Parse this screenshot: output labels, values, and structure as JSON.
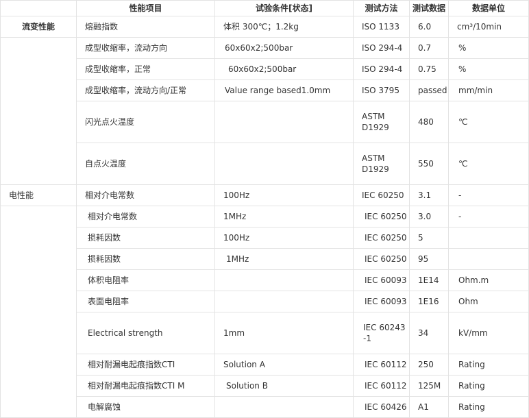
{
  "headers": {
    "category": "",
    "property": "性能项目",
    "condition": "试验条件[状态]",
    "method": "测试方法",
    "value": "测试数据",
    "unit": "数据单位"
  },
  "categories": {
    "rheology": "流变性能",
    "electrical": "电性能"
  },
  "rows": [
    {
      "property": "熔融指数",
      "condition": "体积 300℃；1.2kg",
      "method": "ISO 1133",
      "value": "6.0",
      "unit": "cm³/10min"
    },
    {
      "property": "成型收缩率，流动方向",
      "condition": "60x60x2;500bar",
      "method": "ISO 294-4",
      "value": "0.7",
      "unit": "%"
    },
    {
      "property": "成型收缩率，正常",
      "condition": "60x60x2;500bar",
      "method": "ISO 294-4",
      "value": "0.75",
      "unit": "%"
    },
    {
      "property": "成型收缩率，流动方向/正常",
      "condition": "Value range based1.0mm",
      "method": "ISO 3795",
      "value": "passed",
      "unit": "mm/min"
    },
    {
      "property": "闪光点火温度",
      "condition": "",
      "method": "ASTM D1929",
      "value": "480",
      "unit": "℃"
    },
    {
      "property": "自点火温度",
      "condition": "",
      "method": "ASTM D1929",
      "value": "550",
      "unit": "℃"
    },
    {
      "property": "相对介电常数",
      "condition": "100Hz",
      "method": "IEC 60250",
      "value": "3.1",
      "unit": "-"
    },
    {
      "property": "相对介电常数",
      "condition": "1MHz",
      "method": "IEC 60250",
      "value": "3.0",
      "unit": "-"
    },
    {
      "property": "损耗因数",
      "condition": "100Hz",
      "method": "IEC 60250",
      "value": "5",
      "unit": ""
    },
    {
      "property": "损耗因数",
      "condition": "1MHz",
      "method": "IEC 60250",
      "value": "95",
      "unit": ""
    },
    {
      "property": "体积电阻率",
      "condition": "",
      "method": "IEC 60093",
      "value": "1E14",
      "unit": "Ohm.m"
    },
    {
      "property": "表面电阻率",
      "condition": "",
      "method": "IEC 60093",
      "value": "1E16",
      "unit": "Ohm"
    },
    {
      "property": "Electrical strength",
      "condition": "1mm",
      "method": "IEC 60243-1",
      "value": "34",
      "unit": "kV/mm"
    },
    {
      "property": "相对耐漏电起痕指数CTI",
      "condition": "Solution A",
      "method": "IEC 60112",
      "value": "250",
      "unit": "Rating"
    },
    {
      "property": "相对耐漏电起痕指数CTI M",
      "condition": "Solution B",
      "method": "IEC 60112",
      "value": "125M",
      "unit": "Rating"
    },
    {
      "property": "电解腐蚀",
      "condition": "",
      "method": "IEC 60426",
      "value": "A1",
      "unit": "Rating"
    }
  ]
}
